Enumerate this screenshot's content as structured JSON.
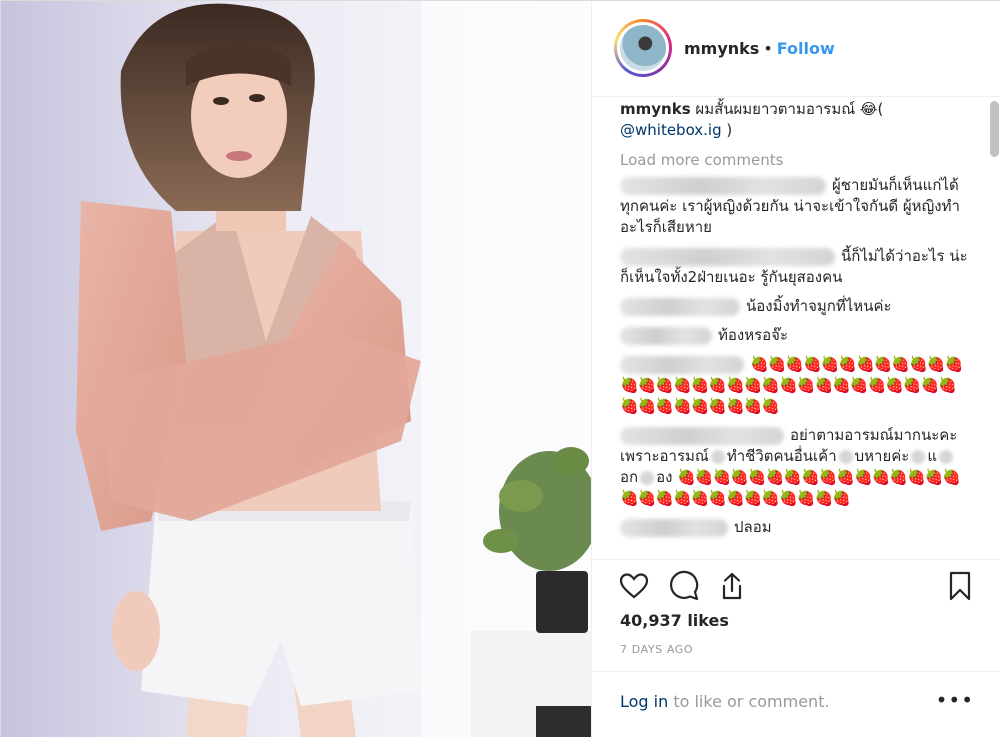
{
  "post": {
    "username": "mmynks",
    "follow_label": "Follow",
    "dot": "•",
    "caption_user": "mmynks",
    "caption_text": "ผมสั้นผมยาวตามอารมณ์ 😂(",
    "caption_mention": "@whitebox.ig",
    "caption_end": ")"
  },
  "comments": {
    "load_more": "Load more comments",
    "items": [
      {
        "text": "ผู้ชายมันก็เห็นแก่ได้ทุกคนค่ะ เราผู้หญิงด้วยกัน น่าจะเข้าใจกันดี ผู้หญิงทำอะไรก็เสียหาย"
      },
      {
        "text": "นี้ก็ไม่ได้ว่าอะไร น่ะ ก็เห็นใจทั้ง2ฝ่ายเนอะ รู้กันยุสองคน"
      },
      {
        "text": "น้องมิ้งทำจมูกที่ไหนค่ะ"
      },
      {
        "text": "ท้องหรอจ๊ะ"
      },
      {
        "text": "🍓🍓🍓🍓🍓🍓🍓🍓🍓🍓🍓🍓🍓🍓🍓🍓🍓🍓🍓🍓🍓🍓🍓🍓🍓🍓🍓🍓🍓🍓🍓🍓🍓🍓🍓🍓🍓🍓🍓🍓"
      },
      {
        "text_a": "อย่าตามอารมณ์มากนะคะ เพราะอารมณ์",
        "text_b": "ทำชีวิตคนอื่นเค้า",
        "text_c": "บหายค่ะ",
        "text_d": "แ",
        "text_e": "อก",
        "text_f": "อง",
        "strawberries": "🍓🍓🍓🍓🍓🍓🍓🍓🍓🍓🍓🍓🍓🍓🍓🍓🍓🍓🍓🍓🍓🍓🍓🍓🍓🍓🍓🍓🍓"
      },
      {
        "text": "ปลอม"
      }
    ]
  },
  "actions": {
    "like_icon": "heart-icon",
    "comment_icon": "comment-icon",
    "share_icon": "share-icon",
    "save_icon": "bookmark-icon"
  },
  "stats": {
    "likes": "40,937 likes",
    "posted": "7 DAYS AGO"
  },
  "footer": {
    "login": "Log in",
    "rest": " to like or comment.",
    "more": "•••"
  }
}
